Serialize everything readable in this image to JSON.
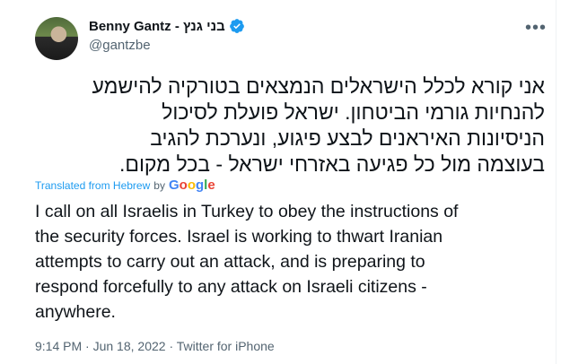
{
  "author": {
    "name": "Benny Gantz - בני גנץ",
    "handle": "@gantzbe",
    "verified": true
  },
  "more_menu": {
    "label": "•••"
  },
  "tweet": {
    "hebrew_lines": [
      "אני קורא לכלל הישראלים הנמצאים בטורקיה להישמע",
      "להנחיות גורמי הביטחון. ישראל פועלת לסיכול",
      "הניסיונות האיראנים לבצע פיגוע, ונערכת להגיב",
      "בעוצמה מול כל פגיעה באזרחי ישראל - בכל מקום."
    ],
    "translated_label": "Translated from Hebrew",
    "translated_by": "by",
    "translator": "Google",
    "english_lines": [
      "I call on all Israelis in Turkey to obey the instructions of",
      "the security forces. Israel is working to thwart Iranian",
      "attempts to carry out an attack, and is preparing to",
      "respond forcefully to any attack on Israeli citizens -",
      "anywhere."
    ]
  },
  "meta": {
    "time": "9:14 PM",
    "separator": "·",
    "date": "Jun 18, 2022",
    "source": "Twitter for iPhone"
  },
  "colors": {
    "accent": "#1d9bf0",
    "text": "#0f1419",
    "muted": "#536471"
  }
}
